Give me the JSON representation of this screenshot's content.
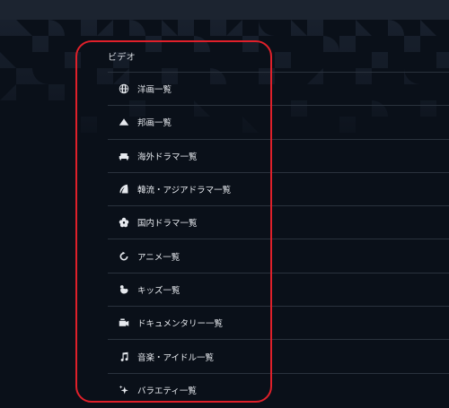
{
  "section": {
    "title": "ビデオ"
  },
  "items": [
    {
      "label": "洋画一覧",
      "icon": "globe-icon"
    },
    {
      "label": "邦画一覧",
      "icon": "mountain-icon"
    },
    {
      "label": "海外ドラマ一覧",
      "icon": "sofa-icon"
    },
    {
      "label": "韓流・アジアドラマ一覧",
      "icon": "leaf-icon"
    },
    {
      "label": "国内ドラマ一覧",
      "icon": "flower-icon"
    },
    {
      "label": "アニメ一覧",
      "icon": "circle-arrow-icon"
    },
    {
      "label": "キッズ一覧",
      "icon": "hand-icon"
    },
    {
      "label": "ドキュメンタリー一覧",
      "icon": "camera-icon"
    },
    {
      "label": "音楽・アイドル一覧",
      "icon": "music-note-icon"
    },
    {
      "label": "バラエティ一覧",
      "icon": "sparkle-icon"
    }
  ],
  "colors": {
    "background": "#0a1019",
    "topbar": "#1c2430",
    "divider": "#2a323d",
    "text": "#e6e9ee",
    "highlight": "#e0202a"
  }
}
